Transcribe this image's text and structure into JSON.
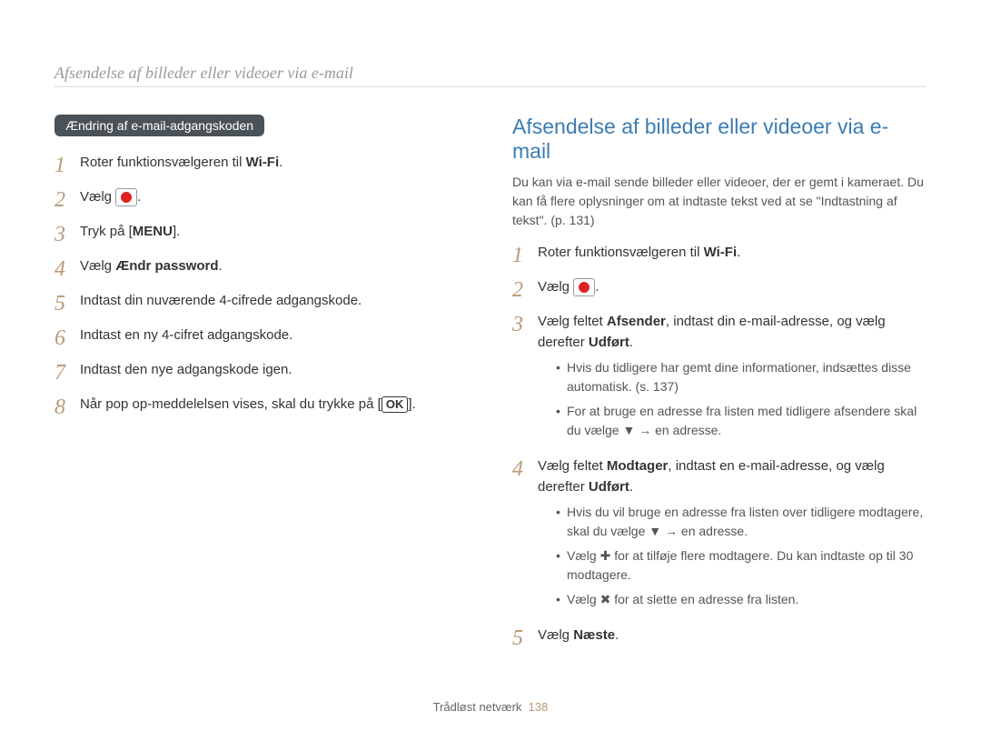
{
  "breadcrumb": "Afsendelse af billeder eller videoer via e-mail",
  "left": {
    "pill": "Ændring af e-mail-adgangskoden",
    "steps": [
      {
        "num": "1",
        "pre": "Roter funktionsvælgeren til ",
        "bold": "Wi-Fi",
        "post": "."
      },
      {
        "num": "2",
        "pre": "Vælg ",
        "icon": "email",
        "post": "."
      },
      {
        "num": "3",
        "pre": "Tryk på [",
        "bold": "MENU",
        "post": "]."
      },
      {
        "num": "4",
        "pre": "Vælg ",
        "bold": "Ændr password",
        "post": "."
      },
      {
        "num": "5",
        "pre": "Indtast din nuværende 4-cifrede adgangskode."
      },
      {
        "num": "6",
        "pre": "Indtast en ny 4-cifret adgangskode."
      },
      {
        "num": "7",
        "pre": "Indtast den nye adgangskode igen."
      },
      {
        "num": "8",
        "pre": "Når pop op-meddelelsen vises, skal du trykke på [",
        "okbtn": "OK",
        "post": "]."
      }
    ]
  },
  "right": {
    "title": "Afsendelse af billeder eller videoer via e-mail",
    "intro": "Du kan via e-mail sende billeder eller videoer, der er gemt i kameraet. Du kan få flere oplysninger om at indtaste tekst ved at se \"Indtastning af tekst\". (p. 131)",
    "steps": [
      {
        "num": "1",
        "pre": "Roter funktionsvælgeren til ",
        "bold": "Wi-Fi",
        "post": "."
      },
      {
        "num": "2",
        "pre": "Vælg ",
        "icon": "email",
        "post": "."
      },
      {
        "num": "3",
        "line": {
          "a": "Vælg feltet ",
          "b": "Afsender",
          "c": ", indtast din e-mail-adresse, og vælg derefter ",
          "d": "Udført",
          "e": "."
        },
        "sub": [
          "Hvis du tidligere har gemt dine informationer, indsættes disse automatisk. (s. 137)",
          "For at bruge en adresse fra listen med tidligere afsendere skal du vælge ▼ → en adresse."
        ]
      },
      {
        "num": "4",
        "line": {
          "a": "Vælg feltet ",
          "b": "Modtager",
          "c": ", indtast en e-mail-adresse, og vælg derefter ",
          "d": "Udført",
          "e": "."
        },
        "sub": [
          "Hvis du vil bruge en adresse fra listen over tidligere modtagere, skal du vælge ▼ → en adresse.",
          "Vælg ✚ for at tilføje flere modtagere. Du kan indtaste op til 30 modtagere.",
          "Vælg ✖ for at slette en adresse fra listen."
        ]
      },
      {
        "num": "5",
        "pre": "Vælg ",
        "bold": "Næste",
        "post": "."
      }
    ]
  },
  "footer": {
    "label": "Trådløst netværk",
    "page": "138"
  }
}
